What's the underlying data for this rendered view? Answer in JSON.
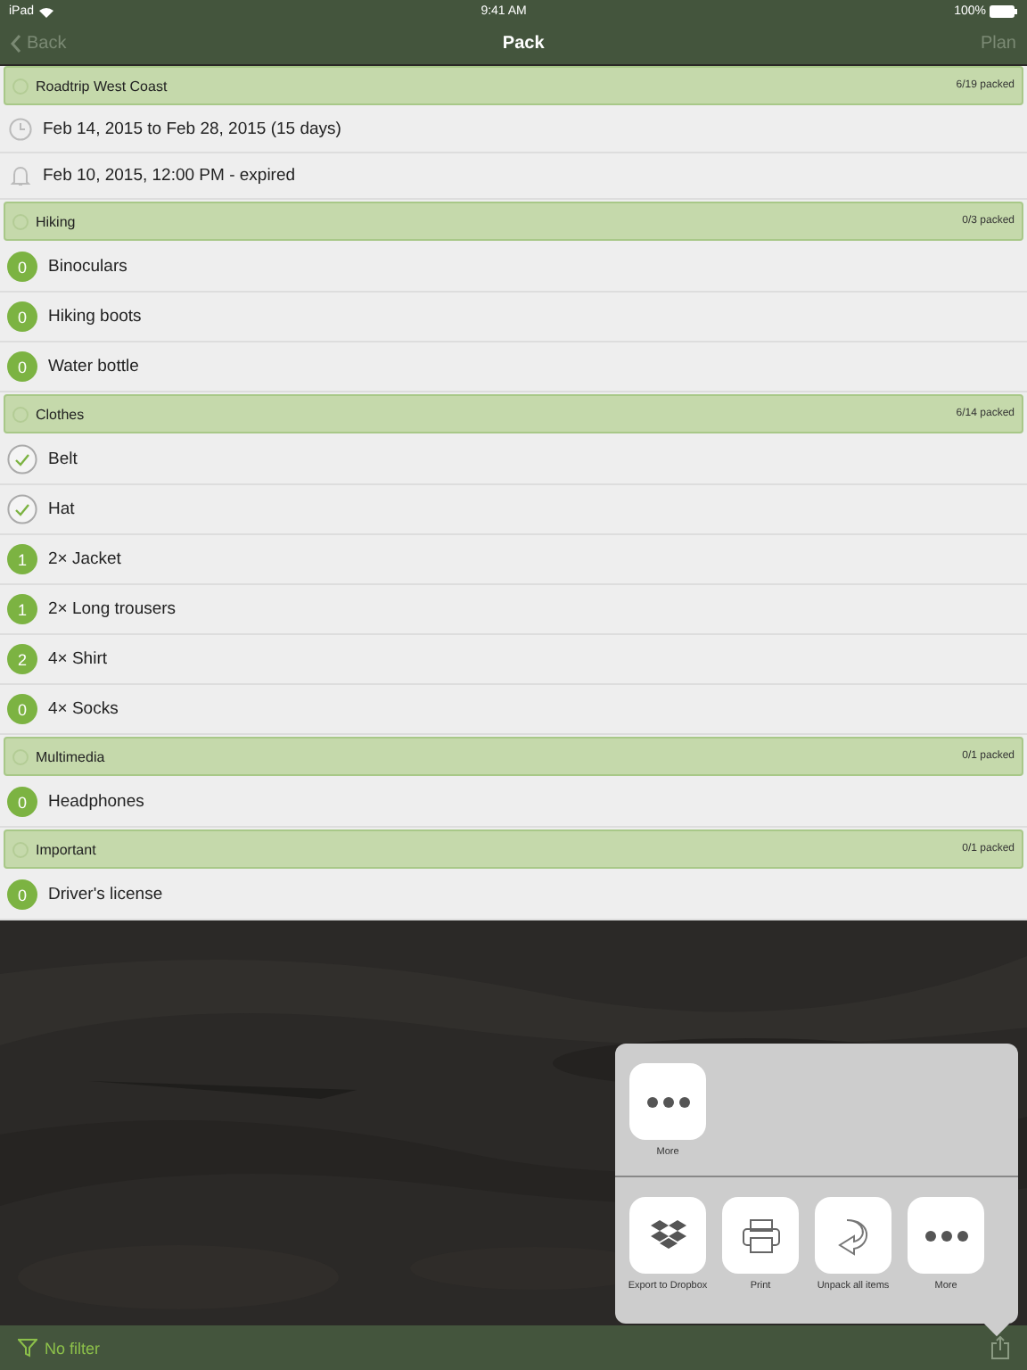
{
  "status_bar": {
    "device": "iPad",
    "time": "9:41 AM",
    "battery": "100%"
  },
  "nav": {
    "back": "Back",
    "title": "Pack",
    "action": "Plan"
  },
  "trip": {
    "title": "Roadtrip West Coast",
    "progress": "6/19 packed",
    "details": [
      {
        "kind": "dates",
        "text": "Feb 14, 2015 to Feb 28, 2015 (15 days)"
      },
      {
        "kind": "reminder",
        "text": "Feb 10, 2015, 12:00 PM - expired"
      }
    ]
  },
  "categories": [
    {
      "name": "Hiking",
      "progress": "0/3 packed",
      "items": [
        {
          "label": "Binoculars",
          "packed": false,
          "count": "0"
        },
        {
          "label": "Hiking boots",
          "packed": false,
          "count": "0"
        },
        {
          "label": "Water bottle",
          "packed": false,
          "count": "0"
        }
      ]
    },
    {
      "name": "Clothes",
      "progress": "6/14 packed",
      "items": [
        {
          "label": "Belt",
          "packed": true
        },
        {
          "label": "Hat",
          "packed": true
        },
        {
          "label": "2× Jacket",
          "packed": false,
          "count": "1"
        },
        {
          "label": "2× Long trousers",
          "packed": false,
          "count": "1"
        },
        {
          "label": "4× Shirt",
          "packed": false,
          "count": "2"
        },
        {
          "label": "4× Socks",
          "packed": false,
          "count": "0"
        }
      ]
    },
    {
      "name": "Multimedia",
      "progress": "0/1 packed",
      "items": [
        {
          "label": "Headphones",
          "packed": false,
          "count": "0"
        }
      ]
    },
    {
      "name": "Important",
      "progress": "0/1 packed",
      "items": [
        {
          "label": "Driver's license",
          "packed": false,
          "count": "0"
        }
      ]
    }
  ],
  "share_sheet": {
    "top_actions": [
      {
        "kind": "more",
        "label": "More"
      }
    ],
    "bottom_actions": [
      {
        "kind": "dropbox",
        "label": "Export to Dropbox"
      },
      {
        "kind": "print",
        "label": "Print"
      },
      {
        "kind": "unpack",
        "label": "Unpack all items"
      },
      {
        "kind": "more",
        "label": "More"
      }
    ]
  },
  "toolbar": {
    "filter": "No filter"
  }
}
